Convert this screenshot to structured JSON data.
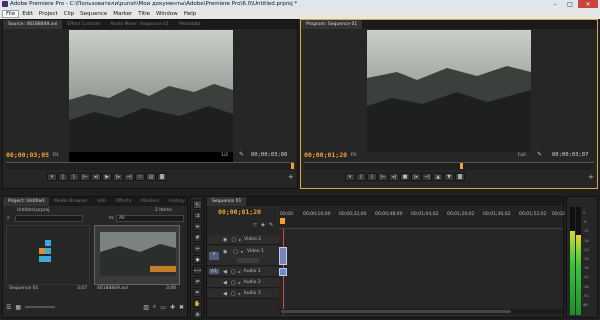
{
  "window": {
    "title": "Adobe Premiere Pro - C:\\Пользователи\\punsh\\Мои документы\\Adobe\\Premiere Pro\\6.0\\Untitled.prproj *",
    "minimize": "–",
    "maximize": "□",
    "close": "✕"
  },
  "menu": [
    "File",
    "Edit",
    "Project",
    "Clip",
    "Sequence",
    "Marker",
    "Title",
    "Window",
    "Help"
  ],
  "source_monitor": {
    "tabs": [
      "Source: 46188849.avi",
      "Effect Controls",
      "Audio Mixer: Sequence 01",
      "Metadata"
    ],
    "timecode_in": "00;00;03;05",
    "fit": "Fit",
    "resolution": "1/2",
    "timecode_dur": "00;00;03;06"
  },
  "program_monitor": {
    "tabs": [
      "Program: Sequence 01"
    ],
    "timecode_in": "00;00;01;20",
    "fit": "Fit",
    "resolution": "Full",
    "timecode_dur": "00;00;03;07"
  },
  "project": {
    "tabs": [
      "Project: Untitled",
      "Media Browser",
      "Info",
      "Effects",
      "Markers",
      "History"
    ],
    "file": "Untitled.prproj",
    "count": "2 Items",
    "in_label": "In:",
    "in_value": "All",
    "items": [
      {
        "name": "Sequence 01",
        "duration": "3;07"
      },
      {
        "name": "46188849.avi",
        "duration": "3;06"
      }
    ]
  },
  "timeline": {
    "tabs": [
      "Sequence 01"
    ],
    "timecode": "00;00;01;20",
    "ruler": [
      "00;00",
      "00;00;16;00",
      "00;00;32;00",
      "00;00;48;00",
      "00;01;04;02",
      "00;01;20;02",
      "00;01;36;02",
      "00;01;52;02",
      "00;02"
    ],
    "tracks": [
      {
        "id": "",
        "name": "Video 2",
        "type": "video"
      },
      {
        "id": "V",
        "name": "Video 1",
        "type": "video"
      },
      {
        "id": "A1",
        "name": "Audio 1",
        "type": "audio"
      },
      {
        "id": "",
        "name": "Audio 2",
        "type": "audio"
      },
      {
        "id": "",
        "name": "Audio 3",
        "type": "audio"
      }
    ]
  },
  "meter": {
    "scale": [
      "0",
      "-6",
      "-12",
      "-18",
      "-24",
      "-30",
      "-36",
      "-42",
      "-48",
      "-54",
      "dB"
    ],
    "level_left": 0.78,
    "level_right": 0.74
  },
  "colors": {
    "accent": "#f0a32f",
    "playhead": "#d14a3b",
    "clip_video": "#7a82b8",
    "clip_audio": "#6a8dc4",
    "meter_green": "#38c23a"
  }
}
